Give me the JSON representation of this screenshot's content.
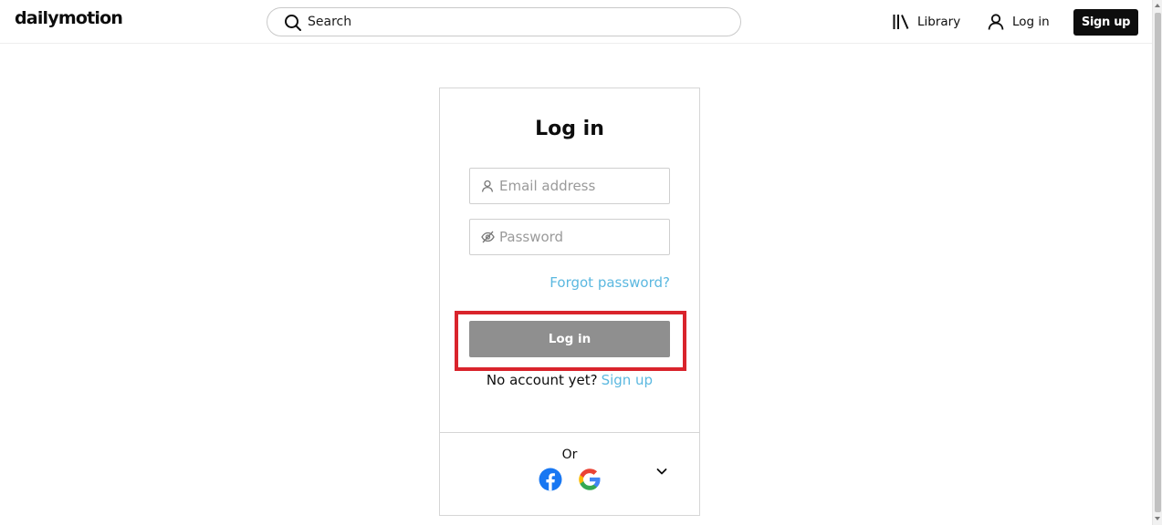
{
  "header": {
    "logo": "dailymotion",
    "search_placeholder": "Search",
    "library_label": "Library",
    "login_label": "Log in",
    "signup_label": "Sign up"
  },
  "login_card": {
    "title": "Log in",
    "email_placeholder": "Email address",
    "password_placeholder": "Password",
    "forgot_password": "Forgot password?",
    "login_button": "Log in",
    "no_account_text": "No account yet?",
    "signup_link": "Sign up",
    "or_text": "Or"
  },
  "icons": {
    "search": "search-icon",
    "library": "library-icon",
    "user": "user-icon",
    "password": "eye-slash-icon",
    "facebook": "facebook-icon",
    "google": "google-icon",
    "expand": "chevron-down-icon"
  },
  "colors": {
    "accent_link": "#5bb8e0",
    "login_button_bg": "#8f8f8f",
    "highlight_border": "#d9242c",
    "facebook_blue": "#1877f2"
  }
}
